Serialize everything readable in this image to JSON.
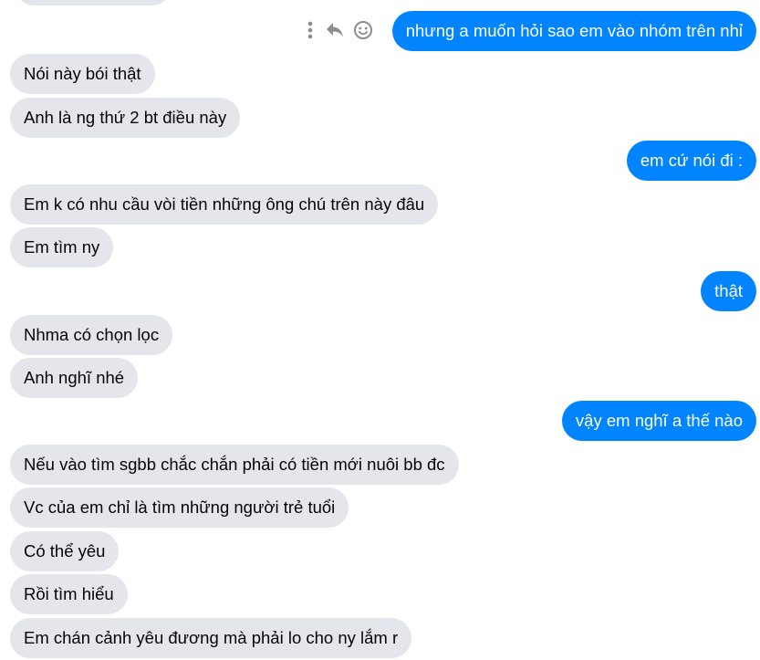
{
  "messages": [
    {
      "side": "out",
      "text": "nhưng a muốn hỏi sao em vào nhóm trên nhỉ"
    },
    {
      "side": "in",
      "text": "Nói này bói thật"
    },
    {
      "side": "in",
      "text": "Anh là ng thứ 2 bt điều này"
    },
    {
      "side": "out",
      "text": "em cứ nói đi :"
    },
    {
      "side": "in",
      "text": "Em k có nhu cầu vòi tiền những ông chú trên này đâu"
    },
    {
      "side": "in",
      "text": "Em tìm ny"
    },
    {
      "side": "out",
      "text": "thật"
    },
    {
      "side": "in",
      "text": "Nhma có chọn lọc"
    },
    {
      "side": "in",
      "text": "Anh nghĩ nhé"
    },
    {
      "side": "out",
      "text": "vậy em nghĩ a thế nào"
    },
    {
      "side": "in",
      "text": "Nếu vào tìm sgbb chắc chắn phải có tiền mới nuôi bb đc"
    },
    {
      "side": "in",
      "text": "Vc của em chỉ là tìm những người trẻ tuổi"
    },
    {
      "side": "in",
      "text": "Có thể yêu"
    },
    {
      "side": "in",
      "text": "Rồi tìm hiểu"
    },
    {
      "side": "in",
      "text": "Em chán cảnh yêu đương mà phải lo cho ny lắm r"
    }
  ],
  "message_actions": [
    "more-options-icon",
    "reply-icon",
    "react-icon"
  ],
  "colors": {
    "outgoing": "#0084ff",
    "incoming": "#e4e6eb",
    "action_icon": "#8a8d91"
  }
}
